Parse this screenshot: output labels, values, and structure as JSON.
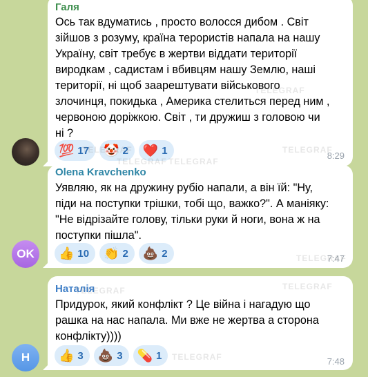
{
  "watermark": "TELEGRAF",
  "messages": [
    {
      "sender": "Галя",
      "sender_color": "#3f8f4f",
      "text": "Ось так вдуматись , просто волосся дибом . Світ\nзійшов з розуму, країна терористів напала на нашу\nУкраїну, світ требує в жертви віддати території\nвиродкам , садистам і вбивцям нашу Землю, наші\nтериторії, ні щоб заарештувати військового\nзлочинця, покидька , Америка стелиться перед ним ,\nчервоною доріжкою. Світ , ти дружиш з головою чи\nні ?",
      "reactions": [
        {
          "emoji": "💯",
          "count": "17"
        },
        {
          "emoji": "🤡",
          "count": "2"
        },
        {
          "emoji": "❤️",
          "count": "1"
        }
      ],
      "time": "8:29",
      "avatar_text": ""
    },
    {
      "sender": "Olena Kravchenko",
      "sender_color": "#2f86a6",
      "text": "Уявляю, як на дружину рубіо напали, а він їй: \"Ну,\nпіди на поступки трішки, тобі що, важко?\". А маніяку:\n\"Не відрізайте голову, тільки руки й ноги, вона ж на\nпоступки пішла\".",
      "reactions": [
        {
          "emoji": "👍",
          "count": "10"
        },
        {
          "emoji": "👏",
          "count": "2"
        },
        {
          "emoji": "💩",
          "count": "2"
        }
      ],
      "time": "7:47",
      "avatar_text": "OK"
    },
    {
      "sender": "Наталія",
      "sender_color": "#3f7fc7",
      "text": "Придурок, який конфлікт ? Це війна і нагадую що\nрашка на нас напала. Ми вже не жертва а сторона\nконфлікту))))",
      "reactions": [
        {
          "emoji": "👍",
          "count": "3"
        },
        {
          "emoji": "💩",
          "count": "3"
        },
        {
          "emoji": "💊",
          "count": "1"
        }
      ],
      "time": "7:48",
      "avatar_text": "Н"
    }
  ]
}
